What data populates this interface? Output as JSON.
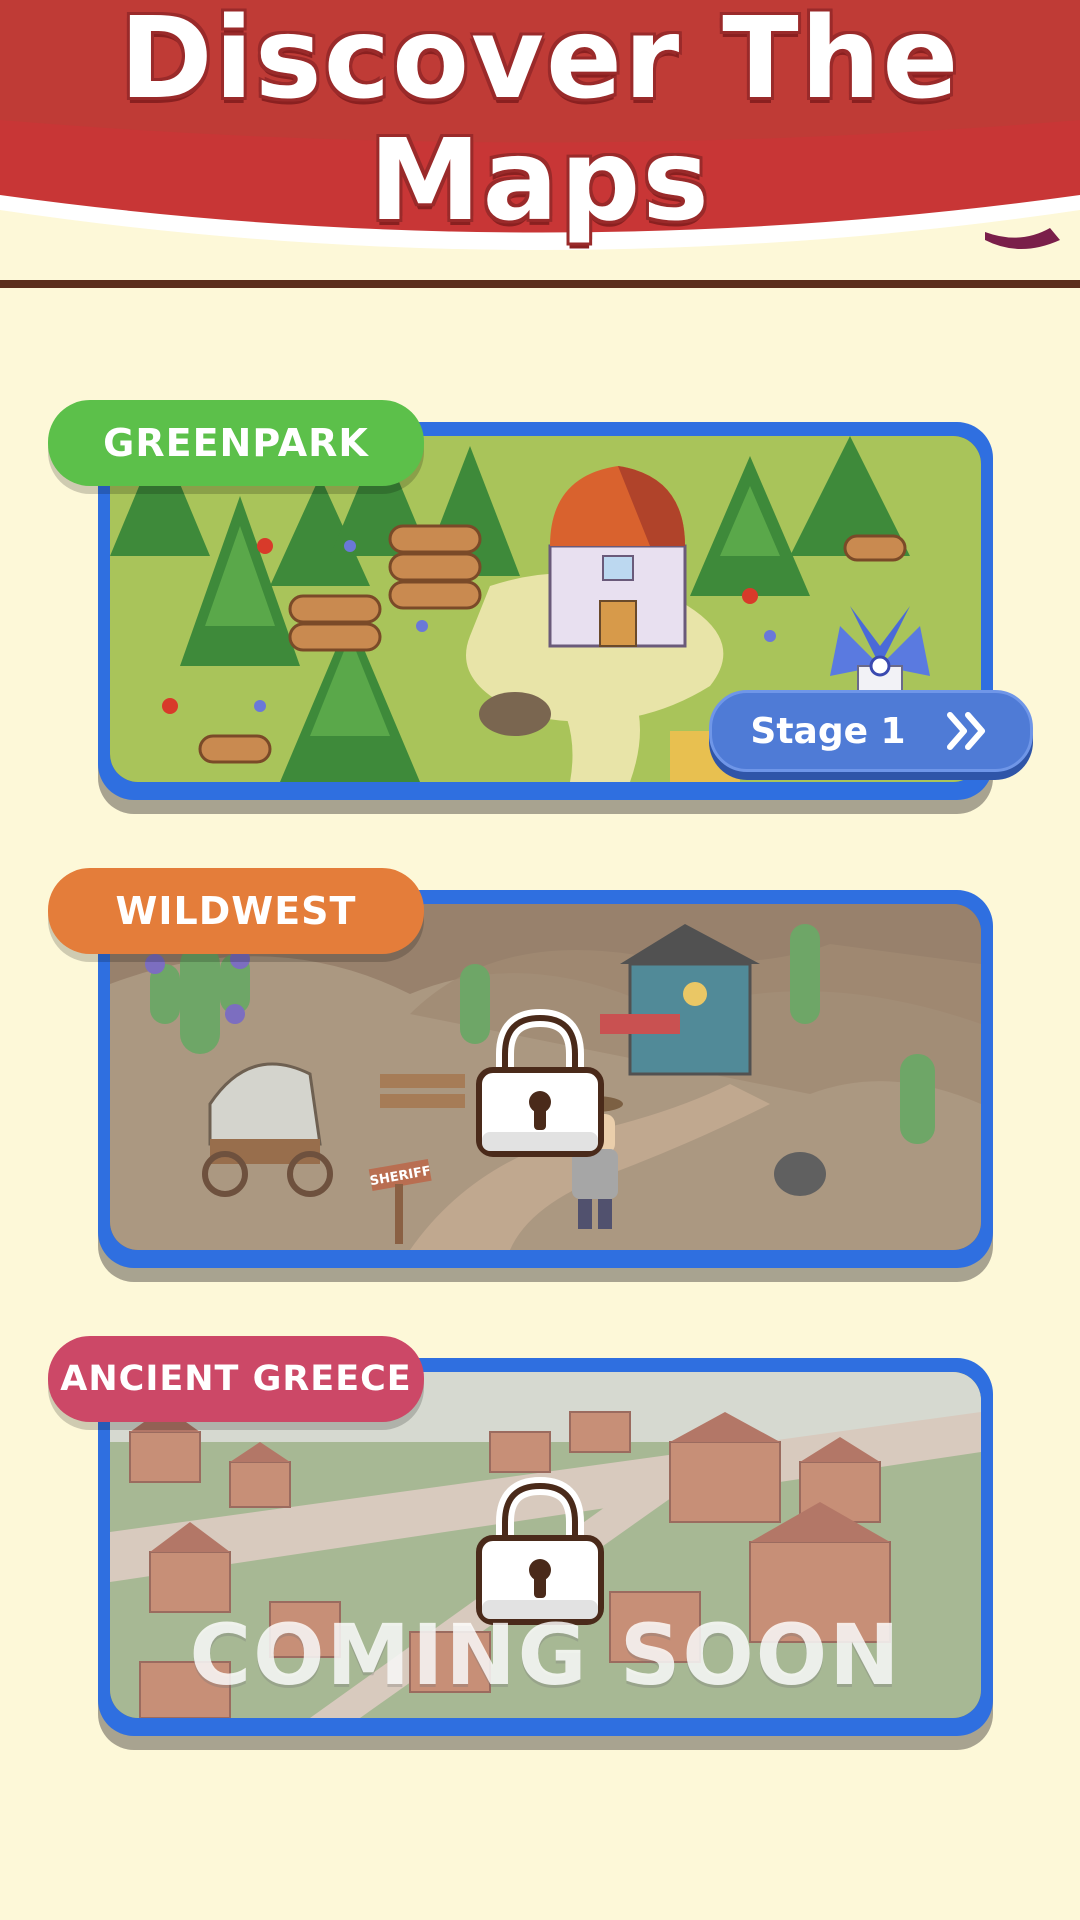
{
  "header": {
    "title_line1": "Discover The",
    "title_line2": "Maps",
    "banner_color": "#c83636"
  },
  "maps": [
    {
      "name": "GREENPARK",
      "tag_color": "#5cc04a",
      "locked": false,
      "button_label": "Stage 1",
      "button_icon": "double-chevron-right-icon"
    },
    {
      "name": "WILDWEST",
      "tag_color": "#e47d3a",
      "locked": true,
      "lock_icon": "padlock-icon",
      "sign_text": "SHERIFF"
    },
    {
      "name": "ANCIENT GREECE",
      "tag_color": "#cc4867",
      "locked": true,
      "lock_icon": "padlock-icon",
      "overlay_text": "COMING SOON"
    }
  ],
  "colors": {
    "background": "#fdf8d8",
    "frame": "#2f6fe0",
    "stage_button": "#4f7bd6"
  }
}
